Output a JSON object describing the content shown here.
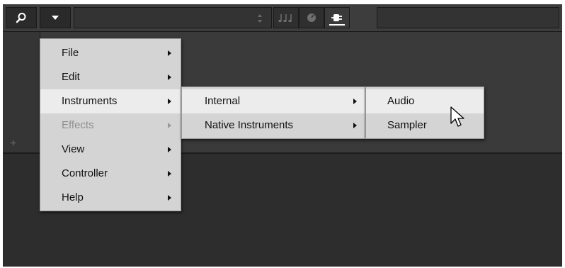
{
  "toolbar": {
    "search_icon": "search-icon",
    "dropdown_icon": "chevron-down-icon",
    "sort_icon": "sort-arrows-icon",
    "tabs": [
      {
        "name": "notes-icon"
      },
      {
        "name": "knob-icon"
      },
      {
        "name": "plug-icon",
        "active": true
      }
    ]
  },
  "track_list": {
    "add_label": "+"
  },
  "main_menu": {
    "items": [
      {
        "label": "File",
        "state": "normal"
      },
      {
        "label": "Edit",
        "state": "normal"
      },
      {
        "label": "Instruments",
        "state": "highlight"
      },
      {
        "label": "Effects",
        "state": "disabled"
      },
      {
        "label": "View",
        "state": "normal"
      },
      {
        "label": "Controller",
        "state": "normal"
      },
      {
        "label": "Help",
        "state": "normal"
      }
    ]
  },
  "instruments_menu": {
    "items": [
      {
        "label": "Internal",
        "state": "highlight"
      },
      {
        "label": "Native Instruments",
        "state": "normal"
      }
    ]
  },
  "internal_menu": {
    "items": [
      {
        "label": "Audio",
        "state": "highlight"
      },
      {
        "label": "Sampler",
        "state": "normal"
      }
    ]
  },
  "colors": {
    "menu_bg": "#d4d4d4",
    "menu_highlight": "#ececec",
    "app_bg": "#2f2f2f",
    "disabled_text": "#8e8e8e"
  }
}
